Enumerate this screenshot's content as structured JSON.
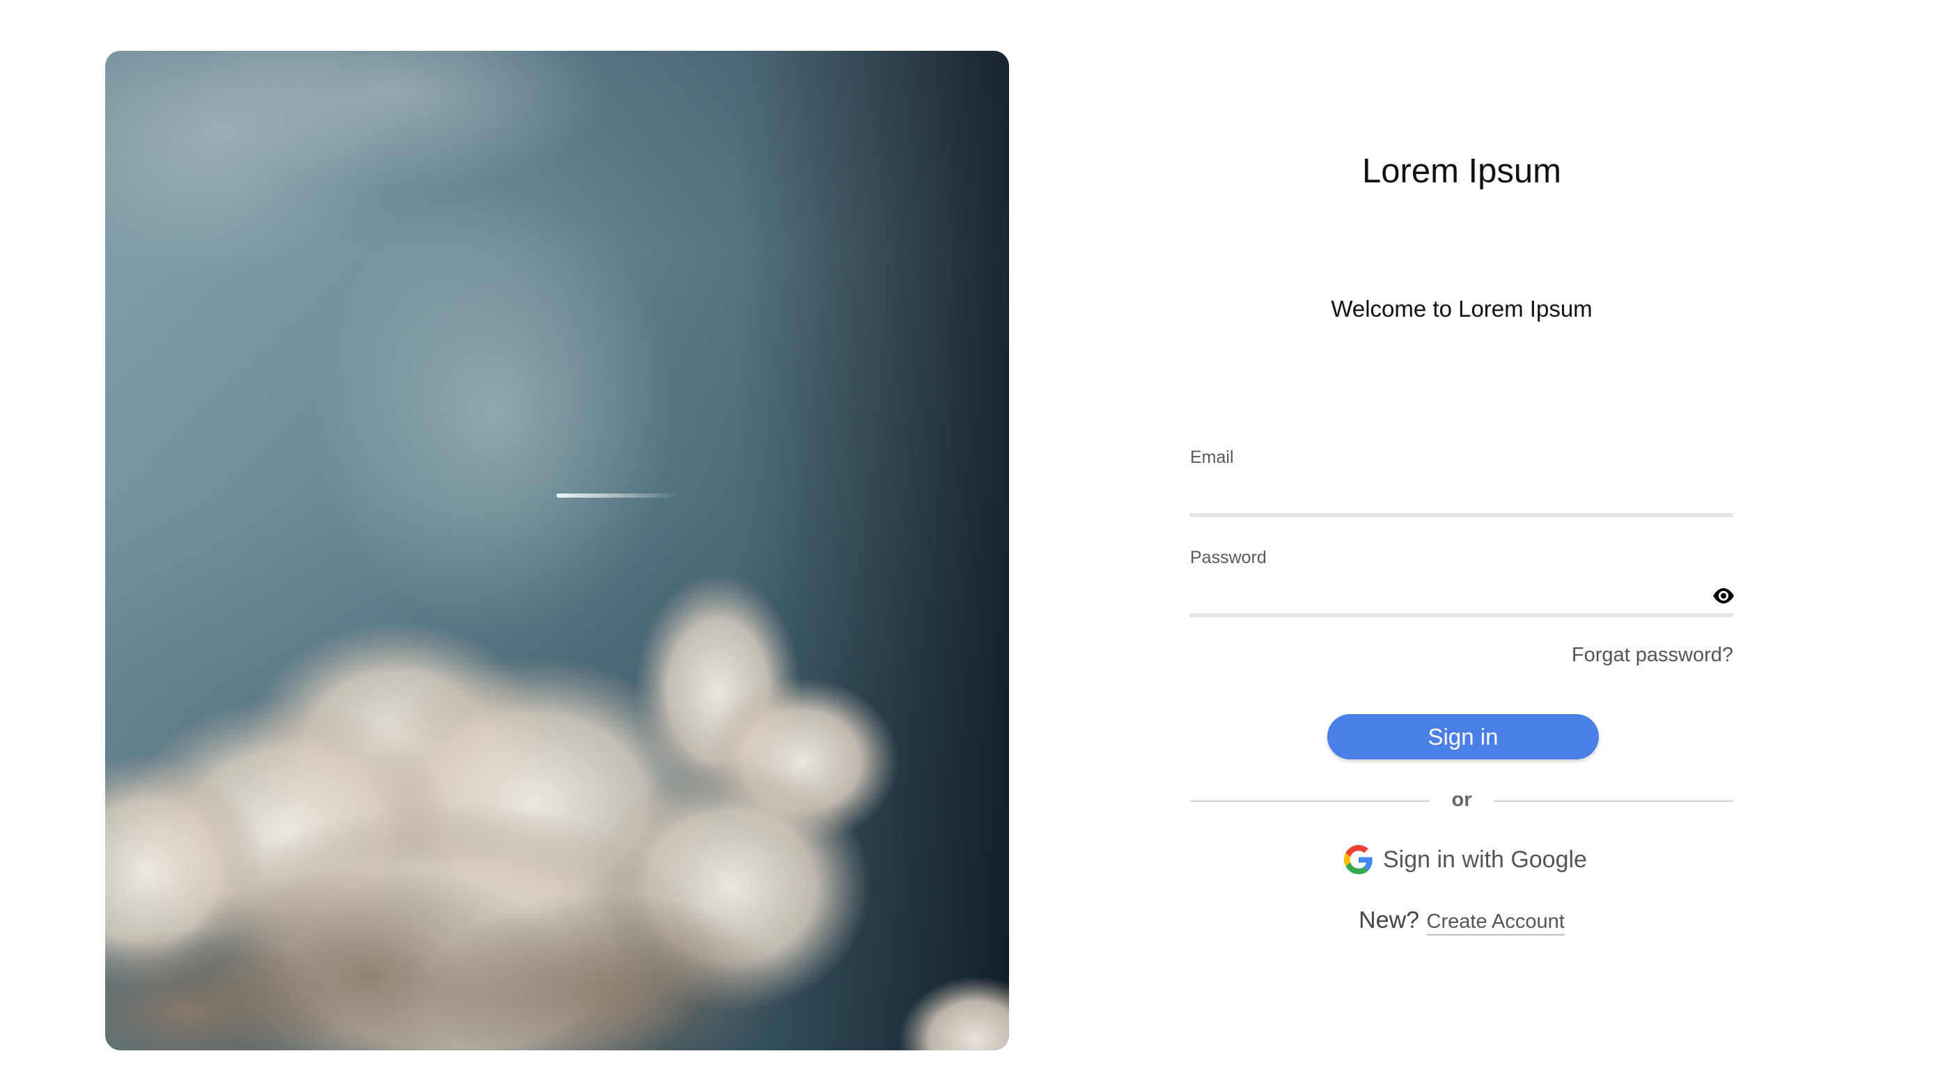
{
  "hero": {
    "image_description_icon": "sky-clouds-image"
  },
  "brand": {
    "title": "Lorem Ipsum"
  },
  "welcome": {
    "text": "Welcome to Lorem Ipsum"
  },
  "form": {
    "email": {
      "label": "Email",
      "value": "",
      "placeholder": ""
    },
    "password": {
      "label": "Password",
      "value": "",
      "placeholder": "",
      "toggle_icon": "eye-icon"
    },
    "forgot_password": "Forgat password?",
    "signin_label": "Sign in",
    "divider_text": "or",
    "google_label": "Sign in with Google",
    "google_icon": "google-icon",
    "new_prompt": "New?",
    "create_account": "Create Account"
  },
  "colors": {
    "primary_button": "#4a7fe8",
    "divider": "#d2d2d2",
    "input_underline": "#e6e6e6"
  }
}
